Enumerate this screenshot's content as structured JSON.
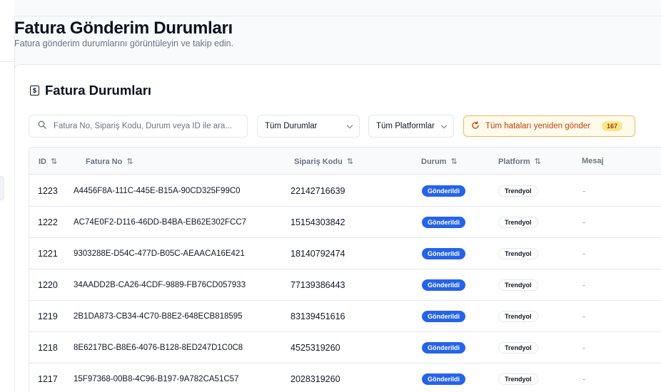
{
  "page": {
    "title": "Fatura Gönderim Durumları",
    "subtitle": "Fatura gönderim durumlarını görüntüleyin ve takip edin."
  },
  "card": {
    "title": "Fatura Durumları",
    "title_icon": "invoice-icon"
  },
  "filters": {
    "search_placeholder": "Fatura No, Sipariş Kodu, Durum veya ID ile ara...",
    "search_value": "",
    "status_selected": "Tüm Durumlar",
    "platform_selected": "Tüm Platformlar",
    "retry_label": "Tüm hataları yeniden gönder",
    "retry_count": "167"
  },
  "table": {
    "columns": [
      "ID",
      "Fatura No",
      "Sipariş Kodu",
      "Durum",
      "Platform",
      "Mesaj"
    ],
    "sort_glyph": "⇅",
    "rows": [
      {
        "id": "1223",
        "invoice": "A4456F8A-111C-445E-B15A-90CD325F99C0",
        "order": "22142716639",
        "status": "Gönderildi",
        "platform": "Trendyol",
        "message": "-"
      },
      {
        "id": "1222",
        "invoice": "AC74E0F2-D116-46DD-B4BA-EB62E302FCC7",
        "order": "15154303842",
        "status": "Gönderildi",
        "platform": "Trendyol",
        "message": "-"
      },
      {
        "id": "1221",
        "invoice": "9303288E-D54C-477D-B05C-AEAACA16E421",
        "order": "18140792474",
        "status": "Gönderildi",
        "platform": "Trendyol",
        "message": "-"
      },
      {
        "id": "1220",
        "invoice": "34AADD2B-CA26-4CDF-9889-FB76CD057933",
        "order": "77139386443",
        "status": "Gönderildi",
        "platform": "Trendyol",
        "message": "-"
      },
      {
        "id": "1219",
        "invoice": "2B1DA873-CB34-4C70-B8E2-648ECB818595",
        "order": "83139451616",
        "status": "Gönderildi",
        "platform": "Trendyol",
        "message": "-"
      },
      {
        "id": "1218",
        "invoice": "8E6217BC-B8E6-4076-B128-8ED247D1C0C8",
        "order": "4525319260",
        "status": "Gönderildi",
        "platform": "Trendyol",
        "message": "-"
      },
      {
        "id": "1217",
        "invoice": "15F97368-00B8-4C96-B197-9A782CA51C57",
        "order": "2028319260",
        "status": "Gönderildi",
        "platform": "Trendyol",
        "message": "-"
      }
    ]
  },
  "colors": {
    "status_badge": "#2563eb",
    "retry_accent": "#c2410c",
    "retry_count_bg": "#fde68a"
  }
}
